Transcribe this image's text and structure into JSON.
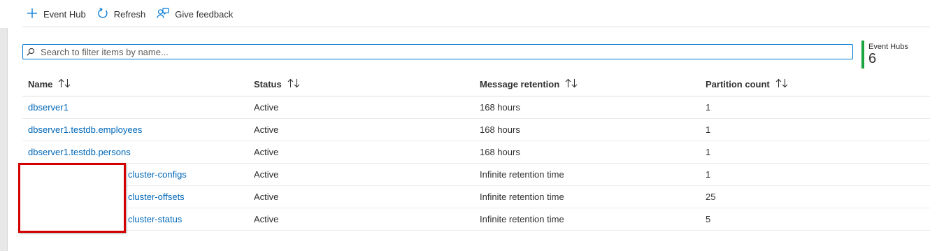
{
  "toolbar": {
    "add_label": "Event Hub",
    "refresh_label": "Refresh",
    "feedback_label": "Give feedback"
  },
  "search": {
    "placeholder": "Search to filter items by name..."
  },
  "summary": {
    "label": "Event Hubs",
    "count": "6",
    "accent_color": "#1aa33e"
  },
  "table": {
    "columns": [
      "Name",
      "Status",
      "Message retention",
      "Partition count"
    ],
    "rows": [
      {
        "name": "dbserver1",
        "status": "Active",
        "retention": "168 hours",
        "partitions": "1"
      },
      {
        "name": "dbserver1.testdb.employees",
        "status": "Active",
        "retention": "168 hours",
        "partitions": "1"
      },
      {
        "name": "dbserver1.testdb.persons",
        "status": "Active",
        "retention": "168 hours",
        "partitions": "1"
      },
      {
        "name": "cluster-configs",
        "status": "Active",
        "retention": "Infinite retention time",
        "partitions": "1"
      },
      {
        "name": "cluster-offsets",
        "status": "Active",
        "retention": "Infinite retention time",
        "partitions": "25"
      },
      {
        "name": "cluster-status",
        "status": "Active",
        "retention": "Infinite retention time",
        "partitions": "5"
      }
    ]
  },
  "colors": {
    "link": "#0067b8",
    "accent": "#0078d4",
    "redaction_border": "#d40000"
  },
  "icons": {
    "add": "plus-icon",
    "refresh": "refresh-icon",
    "feedback": "feedback-icon",
    "search": "search-icon",
    "sort": "sort-icon"
  }
}
